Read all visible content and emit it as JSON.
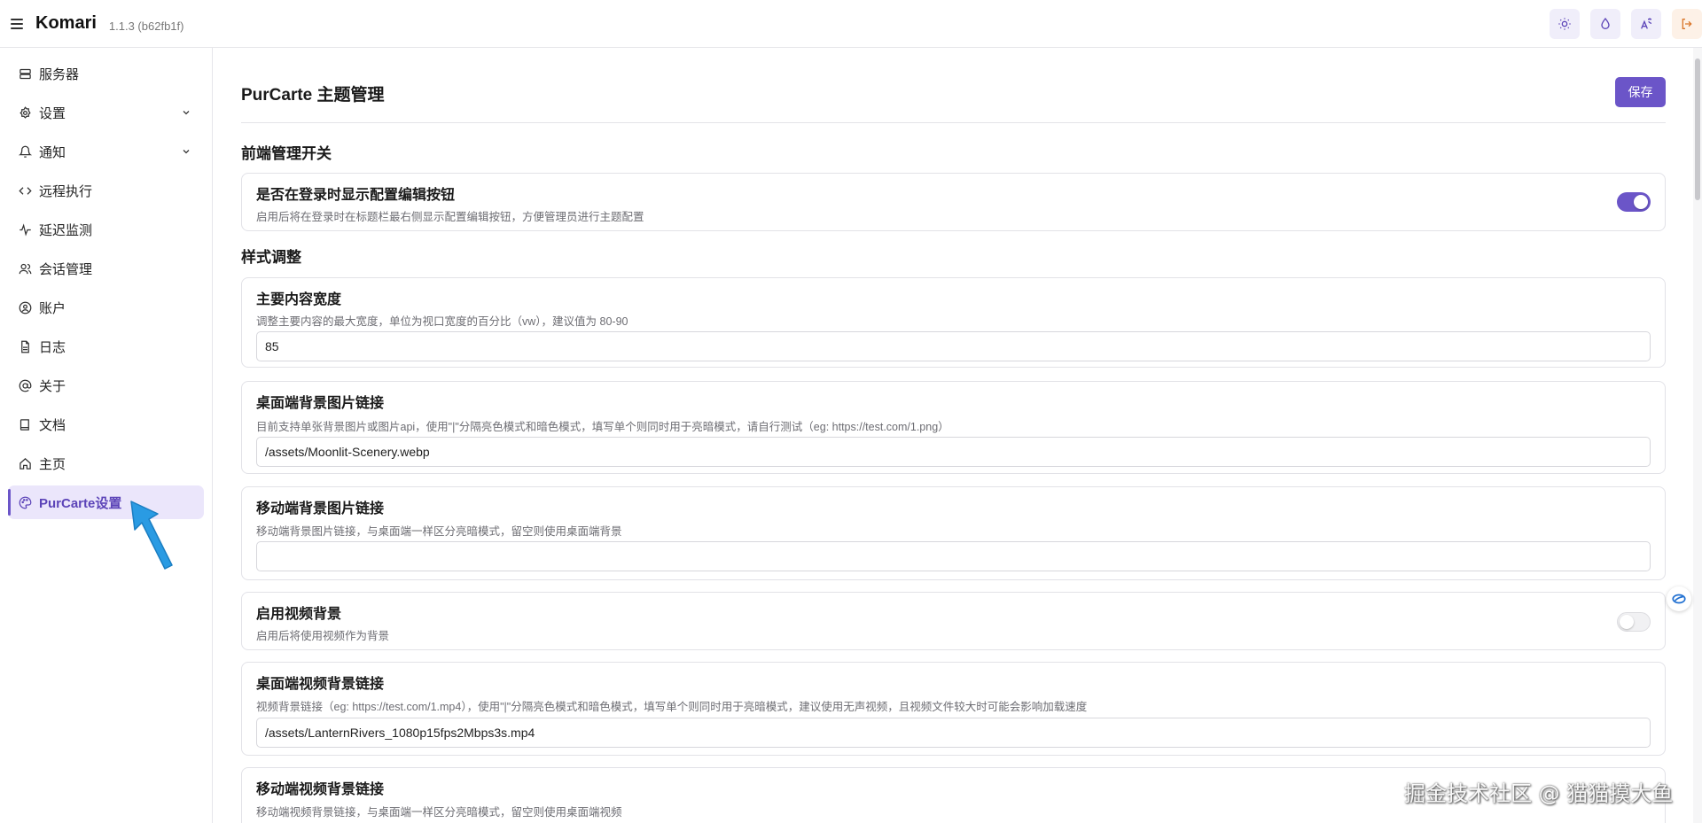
{
  "header": {
    "brand": "Komari",
    "version": "1.1.3 (b62fb1f)",
    "actions": [
      {
        "name": "theme-toggle",
        "icon": "sun-icon"
      },
      {
        "name": "color-scheme",
        "icon": "droplet-icon"
      },
      {
        "name": "language",
        "icon": "translate-icon"
      },
      {
        "name": "logout",
        "icon": "logout-icon"
      }
    ]
  },
  "sidebar": {
    "items": [
      {
        "label": "服务器",
        "icon": "server-icon"
      },
      {
        "label": "设置",
        "icon": "settings-icon",
        "expandable": true
      },
      {
        "label": "通知",
        "icon": "bell-icon",
        "expandable": true
      },
      {
        "label": "远程执行",
        "icon": "code-icon"
      },
      {
        "label": "延迟监测",
        "icon": "activity-icon"
      },
      {
        "label": "会话管理",
        "icon": "users-icon"
      },
      {
        "label": "账户",
        "icon": "user-circle-icon"
      },
      {
        "label": "日志",
        "icon": "file-text-icon"
      },
      {
        "label": "关于",
        "icon": "at-sign-icon"
      },
      {
        "label": "文档",
        "icon": "book-icon"
      },
      {
        "label": "主页",
        "icon": "home-icon"
      },
      {
        "label": "PurCarte设置",
        "icon": "palette-icon",
        "active": true
      }
    ]
  },
  "main": {
    "title": "PurCarte 主题管理",
    "save_label": "保存",
    "sections": {
      "frontend": "前端管理开关",
      "style": "样式调整"
    },
    "settings": {
      "show_edit_button": {
        "title": "是否在登录时显示配置编辑按钮",
        "desc": "启用后将在登录时在标题栏最右侧显示配置编辑按钮，方便管理员进行主题配置",
        "enabled": true
      },
      "content_width": {
        "title": "主要内容宽度",
        "desc": "调整主要内容的最大宽度，单位为视口宽度的百分比（vw），建议值为 80-90",
        "value": "85"
      },
      "desktop_bg_image": {
        "title": "桌面端背景图片链接",
        "desc": "目前支持单张背景图片或图片api，使用\"|\"分隔亮色模式和暗色模式，填写单个则同时用于亮暗模式，请自行测试（eg: https://test.com/1.png）",
        "value": "/assets/Moonlit-Scenery.webp"
      },
      "mobile_bg_image": {
        "title": "移动端背景图片链接",
        "desc": "移动端背景图片链接，与桌面端一样区分亮暗模式，留空则使用桌面端背景",
        "value": ""
      },
      "video_bg": {
        "title": "启用视频背景",
        "desc": "启用后将使用视频作为背景",
        "enabled": false
      },
      "desktop_video": {
        "title": "桌面端视频背景链接",
        "desc": "视频背景链接（eg: https://test.com/1.mp4），使用\"|\"分隔亮色模式和暗色模式，填写单个则同时用于亮暗模式，建议使用无声视频，且视频文件较大时可能会影响加载速度",
        "value": "/assets/LanternRivers_1080p15fps2Mbps3s.mp4"
      },
      "mobile_video": {
        "title": "移动端视频背景链接",
        "desc": "移动端视频背景链接，与桌面端一样区分亮暗模式，留空则使用桌面端视频"
      }
    }
  },
  "watermark": "掘金技术社区 @ 猫猫摸大鱼",
  "colors": {
    "accent": "#6b55c8",
    "active_bg": "#ebe6fb"
  }
}
